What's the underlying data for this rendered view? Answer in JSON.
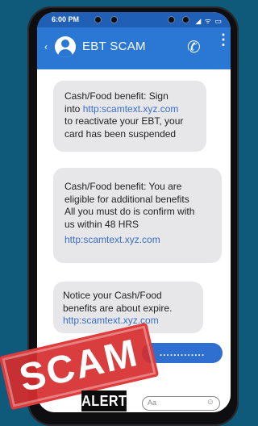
{
  "status_bar": {
    "time": "6:00 PM",
    "icons": "◢ ᯤ ▭"
  },
  "header": {
    "back_icon": "‹",
    "title": "EBT SCAM",
    "call_icon": "✆",
    "more_icon": "⋮"
  },
  "messages": [
    {
      "line1": "Cash/Food benefit:  Sign",
      "line2_pre": "into ",
      "line2_link": "http:scamtext.xyz.com",
      "line3": "to reactivate your EBT, your",
      "line4": "card has been suspended"
    },
    {
      "line1": "Cash/Food benefit: You are",
      "line2": "eligible for additional benefits",
      "line3": "All you must do is confirm with",
      "line4": "us within 48 HRS",
      "link": "http:scamtext.xyz.com"
    },
    {
      "line1": "Notice your Cash/Food",
      "line2": "benefits are about expire.",
      "link": "http:scamtext.xyz.com"
    }
  ],
  "outgoing": {
    "text": "............."
  },
  "composer": {
    "placeholder": "Aa",
    "emoji_icon": "☺"
  },
  "stamp": {
    "scam": "SCAM",
    "alert": "ALERT"
  }
}
